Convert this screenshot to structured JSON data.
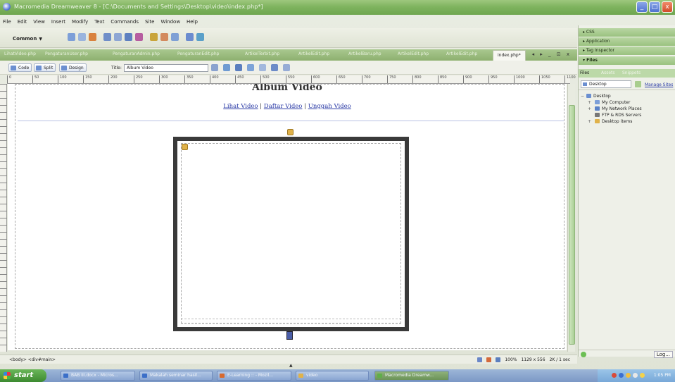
{
  "window": {
    "title": "Macromedia Dreamweaver 8 - [C:\\Documents and Settings\\Desktop\\video\\index.php*]",
    "controls": [
      "_",
      "□",
      "x"
    ]
  },
  "menu": [
    "File",
    "Edit",
    "View",
    "Insert",
    "Modify",
    "Text",
    "Commands",
    "Site",
    "Window",
    "Help"
  ],
  "insertbar": {
    "category": "Common",
    "caret": "▼"
  },
  "doc_tabs": [
    "LihatVideo.php",
    "PengaturanUser.php",
    "PengaturanAdmin.php",
    "PengaturanEdit.php",
    "ArtikelTerbit.php",
    "ArtikelEdit.php",
    "ArtikelBaru.php",
    "ArtikelEdit.php",
    "ArtikelEdit.php",
    "index.php*"
  ],
  "doc_window_controls": "◂ ▸ _ ⊡ x",
  "doc_toolbar": {
    "code": "Code",
    "split": "Split",
    "design": "Design",
    "title_label": "Title:",
    "title_value": "Album Video"
  },
  "ruler_ticks": [
    "0",
    "50",
    "100",
    "150",
    "200",
    "250",
    "300",
    "350",
    "400",
    "450",
    "500",
    "550",
    "600",
    "650",
    "700",
    "750",
    "800",
    "850",
    "900",
    "950",
    "1000",
    "1050",
    "1100"
  ],
  "page": {
    "heading": "Album Video",
    "links": [
      "Lihat Video",
      "Daftar Video",
      "Unggah Video"
    ],
    "separator": " | "
  },
  "status": {
    "tag_selector": "<body> <div#main>",
    "zoom": "100%",
    "dimensions": "1129 x 556",
    "size_time": "2K / 1 sec"
  },
  "panels": {
    "css": "▸ CSS",
    "application": "▸ Application",
    "tag_inspector": "▸ Tag Inspector",
    "files": "▾ Files",
    "files_tabs": [
      "Files",
      "Assets",
      "Snippets"
    ],
    "site_select": "Desktop",
    "manage_sites": "Manage Sites",
    "tree": [
      {
        "label": "Desktop",
        "level": 0,
        "expander": "−"
      },
      {
        "label": "My Computer",
        "level": 1,
        "expander": "+"
      },
      {
        "label": "My Network Places",
        "level": 1,
        "expander": "+"
      },
      {
        "label": "FTP & RDS Servers",
        "level": 1,
        "expander": ""
      },
      {
        "label": "Desktop items",
        "level": 1,
        "expander": "+"
      }
    ],
    "log_button": "Log..."
  },
  "taskbar": {
    "start": "start",
    "buttons": [
      {
        "label": "BAB III.docx - Micros..."
      },
      {
        "label": "Makalah seminar hasil..."
      },
      {
        "label": "E-Learning :: - Mozil..."
      },
      {
        "label": "video"
      },
      {
        "label": "Macromedia Dreamw..."
      }
    ],
    "clock": "1:05 PM"
  },
  "colors": {
    "titlebar": "#7fb45f",
    "link": "#2a3aa6",
    "frame": "#3a3a3a"
  }
}
